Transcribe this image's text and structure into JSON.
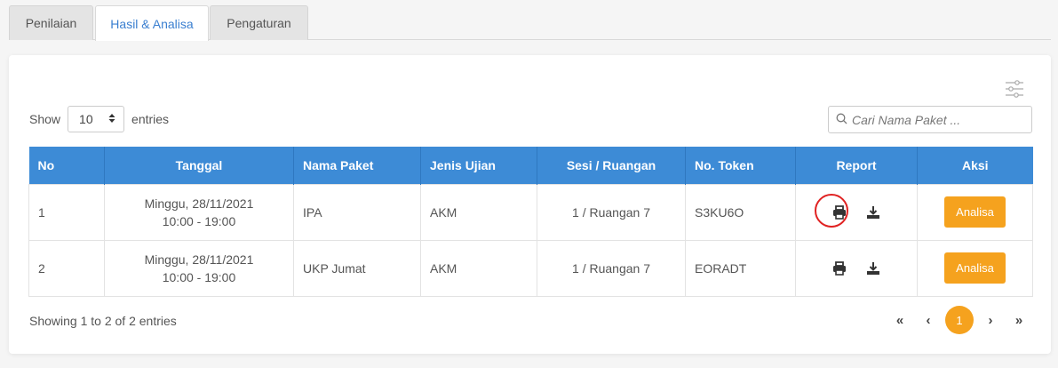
{
  "tabs": [
    {
      "label": "Penilaian"
    },
    {
      "label": "Hasil & Analisa"
    },
    {
      "label": "Pengaturan"
    }
  ],
  "length": {
    "show_label": "Show",
    "value": "10",
    "entries_label": "entries"
  },
  "search": {
    "placeholder": "Cari Nama Paket ..."
  },
  "table": {
    "headers": [
      "No",
      "Tanggal",
      "Nama Paket",
      "Jenis Ujian",
      "Sesi / Ruangan",
      "No. Token",
      "Report",
      "Aksi"
    ],
    "rows": [
      {
        "no": "1",
        "date": "Minggu, 28/11/2021",
        "time": "10:00 - 19:00",
        "paket": "IPA",
        "jenis": "AKM",
        "sesi": "1 / Ruangan 7",
        "token": "S3KU6O",
        "action": "Analisa"
      },
      {
        "no": "2",
        "date": "Minggu, 28/11/2021",
        "time": "10:00 - 19:00",
        "paket": "UKP Jumat",
        "jenis": "AKM",
        "sesi": "1 / Ruangan 7",
        "token": "EORADT",
        "action": "Analisa"
      }
    ]
  },
  "info": "Showing 1 to 2 of 2 entries",
  "pagination": {
    "first": "«",
    "prev": "‹",
    "current": "1",
    "next": "›",
    "last": "»"
  },
  "colors": {
    "accent": "#3d8bd6",
    "button": "#f5a21e",
    "highlight": "#e02222"
  },
  "icons": [
    "sliders-icon",
    "search-icon",
    "sort-icon",
    "printer-icon",
    "download-icon"
  ]
}
